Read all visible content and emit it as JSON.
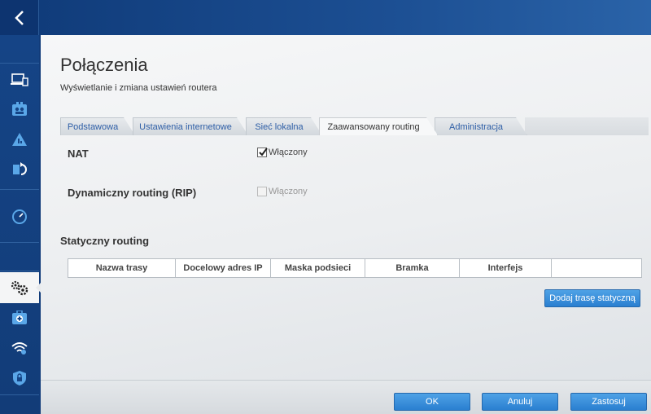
{
  "page": {
    "title": "Połączenia",
    "subtitle": "Wyświetlanie i zmiana ustawień routera"
  },
  "tabs": [
    {
      "label": "Podstawowa",
      "active": false
    },
    {
      "label": "Ustawienia internetowe",
      "active": false
    },
    {
      "label": "Sieć lokalna",
      "active": false
    },
    {
      "label": "Zaawansowany routing",
      "active": true
    },
    {
      "label": "Administracja",
      "active": false
    }
  ],
  "settings": {
    "nat": {
      "label": "NAT",
      "checkbox_label": "Włączony",
      "checked": true,
      "enabled": true
    },
    "rip": {
      "label": "Dynamiczny routing (RIP)",
      "checkbox_label": "Włączony",
      "checked": false,
      "enabled": false
    }
  },
  "static_routing": {
    "heading": "Statyczny routing",
    "columns": [
      "Nazwa trasy",
      "Docelowy adres IP",
      "Maska podsieci",
      "Bramka",
      "Interfejs",
      ""
    ],
    "add_button": "Dodaj trasę statyczną"
  },
  "footer": {
    "ok": "OK",
    "cancel": "Anuluj",
    "apply": "Zastosuj"
  },
  "sidebar": {
    "icons": [
      "back-icon",
      "devices-icon",
      "parental-controls-icon",
      "network-map-icon",
      "media-prioritization-icon",
      "speed-test-icon",
      "connectivity-icon",
      "troubleshooting-icon",
      "wireless-icon",
      "security-icon"
    ],
    "active": "connectivity-icon"
  },
  "colors": {
    "brand_blue": "#123c7a",
    "link_blue": "#2f5fa7",
    "button_blue": "#2a7fd0"
  }
}
